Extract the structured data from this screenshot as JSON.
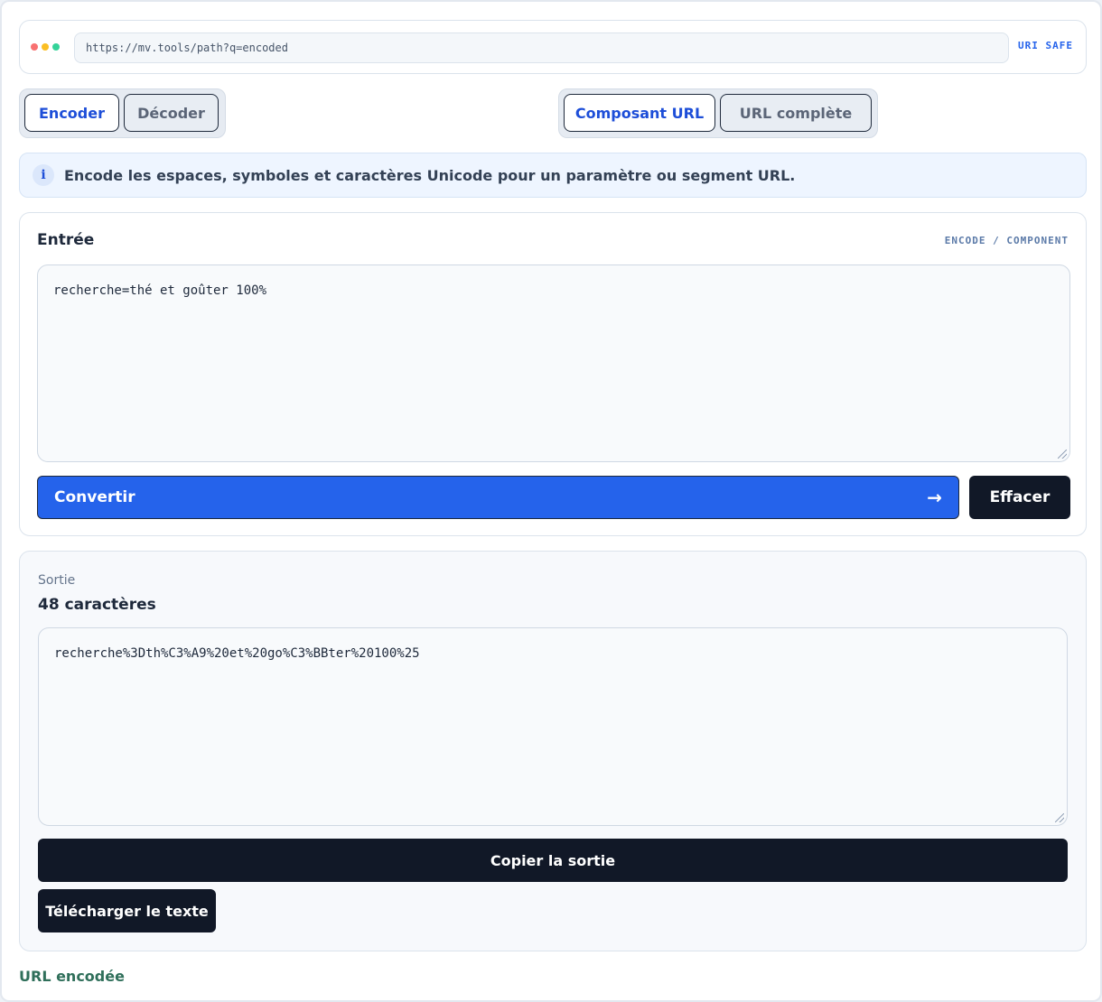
{
  "address_bar": {
    "url": "https://mv.tools/path?q=encoded",
    "badge": "URI SAFE",
    "dot_colors": [
      "#f87171",
      "#fbbf24",
      "#34d399"
    ]
  },
  "mode_toggle": {
    "encode_label": "Encoder",
    "decode_label": "Décoder",
    "selected": "Encoder"
  },
  "scope_toggle": {
    "component_label": "Composant URL",
    "full_label": "URL complète",
    "selected": "Composant URL"
  },
  "info": {
    "icon": "info-icon",
    "glyph": "i",
    "text": "Encode les espaces, symboles et caractères Unicode pour un paramètre ou segment URL."
  },
  "input": {
    "title": "Entrée",
    "tag": "ENCODE / COMPONENT",
    "value": "recherche=thé et goûter 100%",
    "convert_label": "Convertir",
    "convert_icon": "arrow-right-icon",
    "clear_label": "Effacer"
  },
  "output": {
    "label": "Sortie",
    "count": "48 caractères",
    "value": "recherche%3Dth%C3%A9%20et%20go%C3%BBter%20100%25",
    "copy_label": "Copier la sortie",
    "download_label": "Télécharger le texte"
  },
  "footer": {
    "label": "URL encodée"
  },
  "colors": {
    "accent": "#2563eb",
    "dark_button": "#111827",
    "footer_text": "#2f6f5a"
  }
}
